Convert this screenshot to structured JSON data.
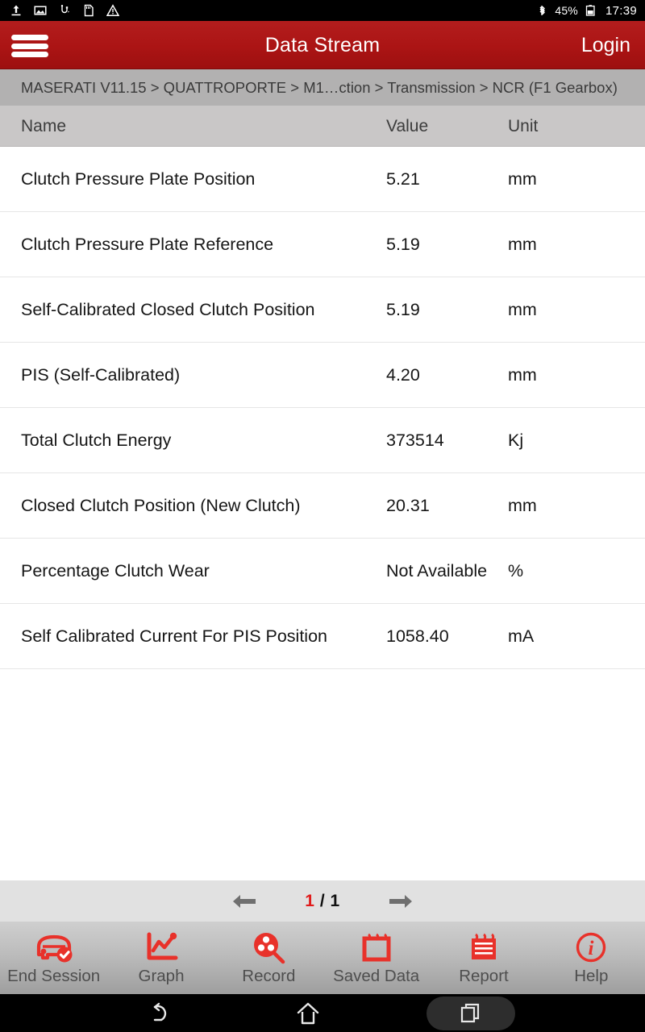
{
  "status_bar": {
    "icons": [
      "upload-icon",
      "screenshot-icon",
      "usb-icon",
      "sd-card-icon",
      "warning-icon"
    ],
    "bluetooth_icon": "bluetooth-icon",
    "battery_percent": "45%",
    "battery_icon": "battery-icon",
    "clock": "17:39"
  },
  "app_bar": {
    "menu_icon": "hamburger-menu-icon",
    "title": "Data Stream",
    "login_label": "Login",
    "background_color": "#ab1414"
  },
  "breadcrumb": {
    "text": "MASERATI V11.15 > QUATTROPORTE > M1…ction > Transmission > NCR (F1 Gearbox)"
  },
  "table": {
    "columns": [
      "Name",
      "Value",
      "Unit"
    ],
    "rows": [
      {
        "name": "Clutch Pressure Plate Position",
        "value": "5.21",
        "unit": "mm"
      },
      {
        "name": "Clutch Pressure Plate Reference",
        "value": "5.19",
        "unit": "mm"
      },
      {
        "name": "Self-Calibrated Closed Clutch Position",
        "value": "5.19",
        "unit": "mm"
      },
      {
        "name": "PIS (Self-Calibrated)",
        "value": "4.20",
        "unit": "mm"
      },
      {
        "name": "Total Clutch Energy",
        "value": "373514",
        "unit": "Kj"
      },
      {
        "name": "Closed Clutch Position (New Clutch)",
        "value": "20.31",
        "unit": "mm"
      },
      {
        "name": "Percentage Clutch Wear",
        "value": "Not Available",
        "unit": "%"
      },
      {
        "name": "Self Calibrated Current For PIS Position",
        "value": "1058.40",
        "unit": "mA"
      }
    ]
  },
  "pager": {
    "prev_icon": "arrow-left-icon",
    "next_icon": "arrow-right-icon",
    "current_page": "1",
    "separator": "/ 1",
    "accent_color": "#e01b1b"
  },
  "toolbar": {
    "accent_color": "#e8312a",
    "items": [
      {
        "icon": "car-check-icon",
        "label": "End Session"
      },
      {
        "icon": "line-chart-icon",
        "label": "Graph"
      },
      {
        "icon": "film-search-icon",
        "label": "Record"
      },
      {
        "icon": "notepad-icon",
        "label": "Saved Data"
      },
      {
        "icon": "notepad-lines-icon",
        "label": "Report"
      },
      {
        "icon": "info-circle-icon",
        "label": "Help"
      }
    ]
  },
  "nav_bar": {
    "back_icon": "back-arrow-icon",
    "home_icon": "home-icon",
    "recents_icon": "recents-icon"
  }
}
